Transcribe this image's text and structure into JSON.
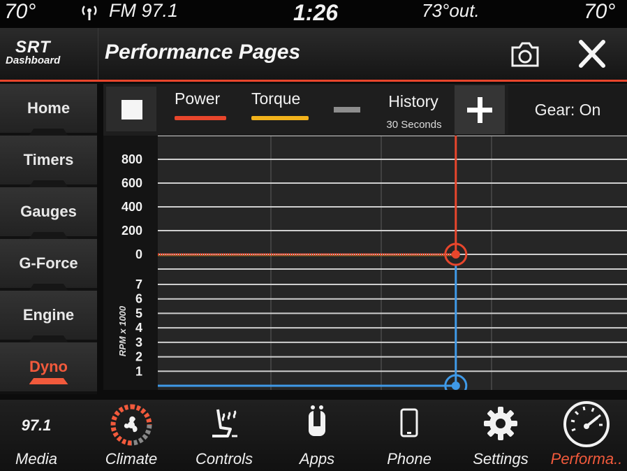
{
  "status": {
    "left_temp": "70°",
    "radio": "FM 97.1",
    "time": "1:26",
    "outside_temp": "73°out.",
    "right_temp": "70°"
  },
  "header": {
    "logo_line1": "SRT",
    "logo_line2": "Dashboard",
    "title": "Performance Pages"
  },
  "nav": {
    "items": [
      {
        "label": "Home"
      },
      {
        "label": "Timers"
      },
      {
        "label": "Gauges"
      },
      {
        "label": "G-Force"
      },
      {
        "label": "Engine"
      },
      {
        "label": "Dyno",
        "active": true
      }
    ]
  },
  "controls": {
    "power_label": "Power",
    "torque_label": "Torque",
    "history_label": "History",
    "history_sub": "30 Seconds",
    "gear_label": "Gear: On"
  },
  "colors": {
    "accent": "#f25a3c",
    "power": "#e8462c",
    "torque": "#f2b21b",
    "rpm": "#3f9ae8"
  },
  "chart_data": {
    "type": "line",
    "panels": [
      {
        "name": "power_torque",
        "y_ticks": [
          "800",
          "600",
          "400",
          "200",
          "0"
        ],
        "ylim": [
          0,
          800
        ],
        "series": [
          {
            "name": "Power",
            "value": 0
          },
          {
            "name": "Torque",
            "value": 0
          }
        ]
      },
      {
        "name": "rpm",
        "ylabel": "RPM x 1000",
        "y_ticks": [
          "7",
          "6",
          "5",
          "4",
          "3",
          "2",
          "1"
        ],
        "ylim": [
          0,
          7
        ],
        "series": [
          {
            "value": 0
          }
        ]
      }
    ],
    "cursor_fraction": 0.65
  },
  "bottom": {
    "media_freq": "97.1",
    "items": [
      {
        "label": "Media",
        "icon": "radio-icon"
      },
      {
        "label": "Climate",
        "icon": "climate-fan-icon"
      },
      {
        "label": "Controls",
        "icon": "heated-seat-icon"
      },
      {
        "label": "Apps",
        "icon": "apps-icon"
      },
      {
        "label": "Phone",
        "icon": "phone-icon"
      },
      {
        "label": "Settings",
        "icon": "gear-icon"
      },
      {
        "label": "Performa..",
        "icon": "speedometer-icon",
        "active": true
      }
    ]
  }
}
